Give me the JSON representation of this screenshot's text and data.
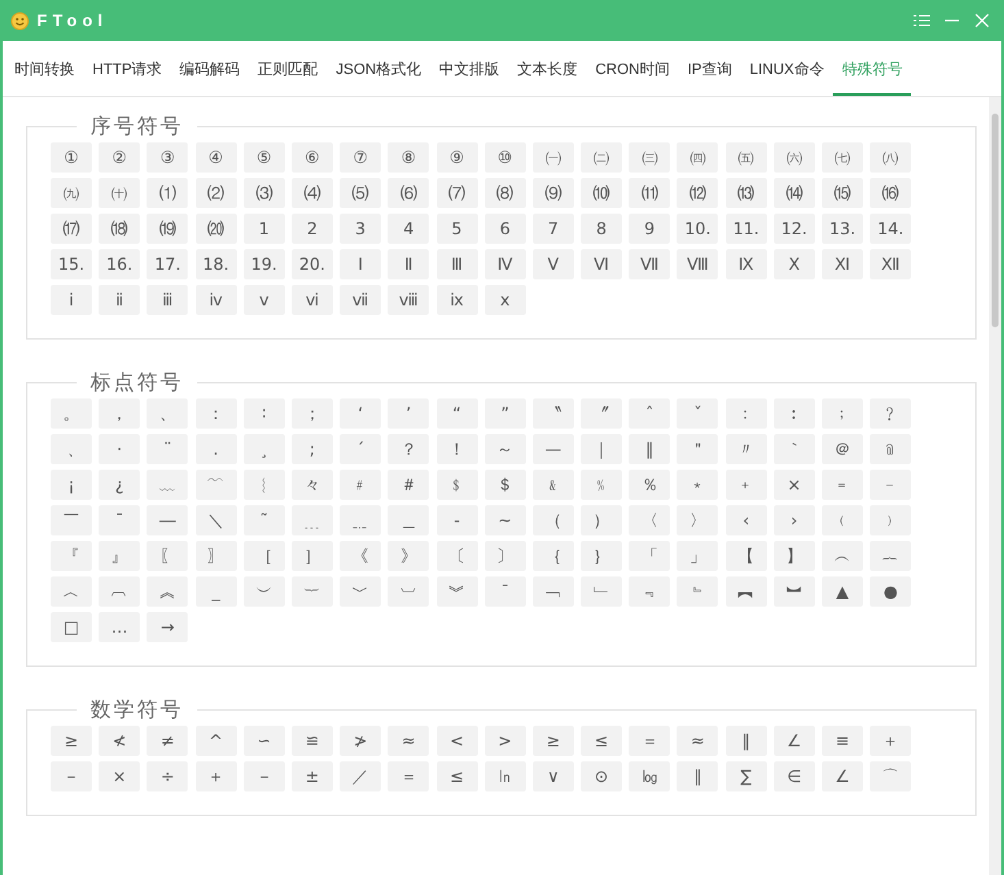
{
  "window": {
    "title": "FTool"
  },
  "tabs": [
    {
      "label": "时间转换",
      "selected": false
    },
    {
      "label": "HTTP请求",
      "selected": false
    },
    {
      "label": "编码解码",
      "selected": false
    },
    {
      "label": "正则匹配",
      "selected": false
    },
    {
      "label": "JSON格式化",
      "selected": false
    },
    {
      "label": "中文排版",
      "selected": false
    },
    {
      "label": "文本长度",
      "selected": false
    },
    {
      "label": "CRON时间",
      "selected": false
    },
    {
      "label": "IP查询",
      "selected": false
    },
    {
      "label": "LINUX命令",
      "selected": false
    },
    {
      "label": "特殊符号",
      "selected": true
    }
  ],
  "sections": [
    {
      "title": "序号符号",
      "symbols": [
        "①",
        "②",
        "③",
        "④",
        "⑤",
        "⑥",
        "⑦",
        "⑧",
        "⑨",
        "⑩",
        "㈠",
        "㈡",
        "㈢",
        "㈣",
        "㈤",
        "㈥",
        "㈦",
        "㈧",
        "㈨",
        "㈩",
        "⑴",
        "⑵",
        "⑶",
        "⑷",
        "⑸",
        "⑹",
        "⑺",
        "⑻",
        "⑼",
        "⑽",
        "⑾",
        "⑿",
        "⒀",
        "⒁",
        "⒂",
        "⒃",
        "⒄",
        "⒅",
        "⒆",
        "⒇",
        "1",
        "2",
        "3",
        "4",
        "5",
        "6",
        "7",
        "8",
        "9",
        "10.",
        "11.",
        "12.",
        "13.",
        "14.",
        "15.",
        "16.",
        "17.",
        "18.",
        "19.",
        "20.",
        "Ⅰ",
        "Ⅱ",
        "Ⅲ",
        "Ⅳ",
        "Ⅴ",
        "Ⅵ",
        "Ⅶ",
        "Ⅷ",
        "Ⅸ",
        "Ⅹ",
        "Ⅺ",
        "Ⅻ",
        "ⅰ",
        "ⅱ",
        "ⅲ",
        "ⅳ",
        "ⅴ",
        "ⅵ",
        "ⅶ",
        "ⅷ",
        "ⅸ",
        "ⅹ"
      ]
    },
    {
      "title": "标点符号",
      "symbols": [
        "。",
        "，",
        "、",
        "：",
        "∶",
        "；",
        "‘",
        "’",
        "“",
        "”",
        "〝",
        "〞",
        "ˆ",
        "ˇ",
        "﹕",
        "︰",
        "﹔",
        "﹖",
        "﹑",
        "·",
        "¨",
        ".",
        "¸",
        ";",
        "´",
        "？",
        "！",
        "～",
        "—",
        "｜",
        "‖",
        "＂",
        "〃",
        "｀",
        "＠",
        "﹫",
        "¡",
        "¿",
        "﹏",
        "﹋",
        "︴",
        "々",
        "﹟",
        "＃",
        "﹩",
        "＄",
        "﹠",
        "﹪",
        "％",
        "﹡",
        "﹢",
        "×",
        "﹦",
        "﹣",
        "￣",
        "¯",
        "―",
        "＼",
        "˜",
        "﹍",
        "﹎",
        "＿",
        "-",
        "~",
        "（",
        "）",
        "〈",
        "〉",
        "‹",
        "›",
        "﹙",
        "﹚",
        "『",
        "』",
        "〖",
        "〗",
        "［",
        "］",
        "《",
        "》",
        "〔",
        "〕",
        "｛",
        "｝",
        "「",
        "」",
        "【",
        "】",
        "︵",
        "︷",
        "︿",
        "︹",
        "︽",
        "_",
        "︶",
        "︸",
        "﹀",
        "︺",
        "︾",
        "ˉ",
        "﹁",
        "﹂",
        "﹃",
        "﹄",
        "︻",
        "︼",
        "▲",
        "●",
        "□",
        "…",
        "→"
      ]
    },
    {
      "title": "数学符号",
      "symbols": [
        "≥",
        "≮",
        "≠",
        "^",
        "∽",
        "≌",
        "≯",
        "≈",
        "<",
        ">",
        "≥",
        "≤",
        "＝",
        "≈",
        "‖",
        "∠",
        "≡",
        "＋",
        "－",
        "×",
        "÷",
        "＋",
        "－",
        "±",
        "／",
        "＝",
        "≤",
        "㏑",
        "∨",
        "⊙",
        "㏒",
        "∥",
        "∑",
        "∈",
        "∠",
        "⌒"
      ]
    }
  ]
}
